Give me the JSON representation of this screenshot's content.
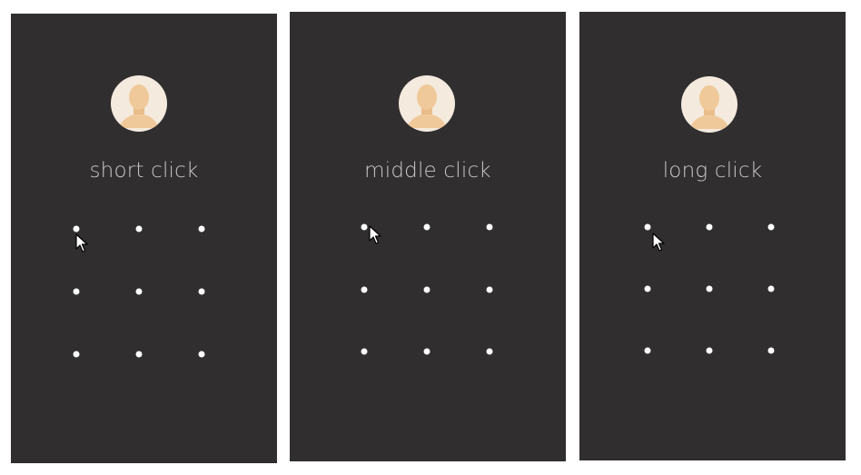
{
  "screens": [
    {
      "caption": "short click",
      "avatar_icon": "user-avatar-icon",
      "pattern_dots": 9,
      "cursor_icon": "mouse-pointer-icon"
    },
    {
      "caption": "middle click",
      "avatar_icon": "user-avatar-icon",
      "pattern_dots": 9,
      "cursor_icon": "mouse-pointer-icon"
    },
    {
      "caption": "long click",
      "avatar_icon": "user-avatar-icon",
      "pattern_dots": 9,
      "cursor_icon": "mouse-pointer-icon"
    }
  ],
  "colors": {
    "screen_background": "#302e2f",
    "caption_text": "#c9c7c7",
    "dot": "#ffffff",
    "avatar_background": "#f4eadd",
    "avatar_figure": "#f0c99a"
  }
}
